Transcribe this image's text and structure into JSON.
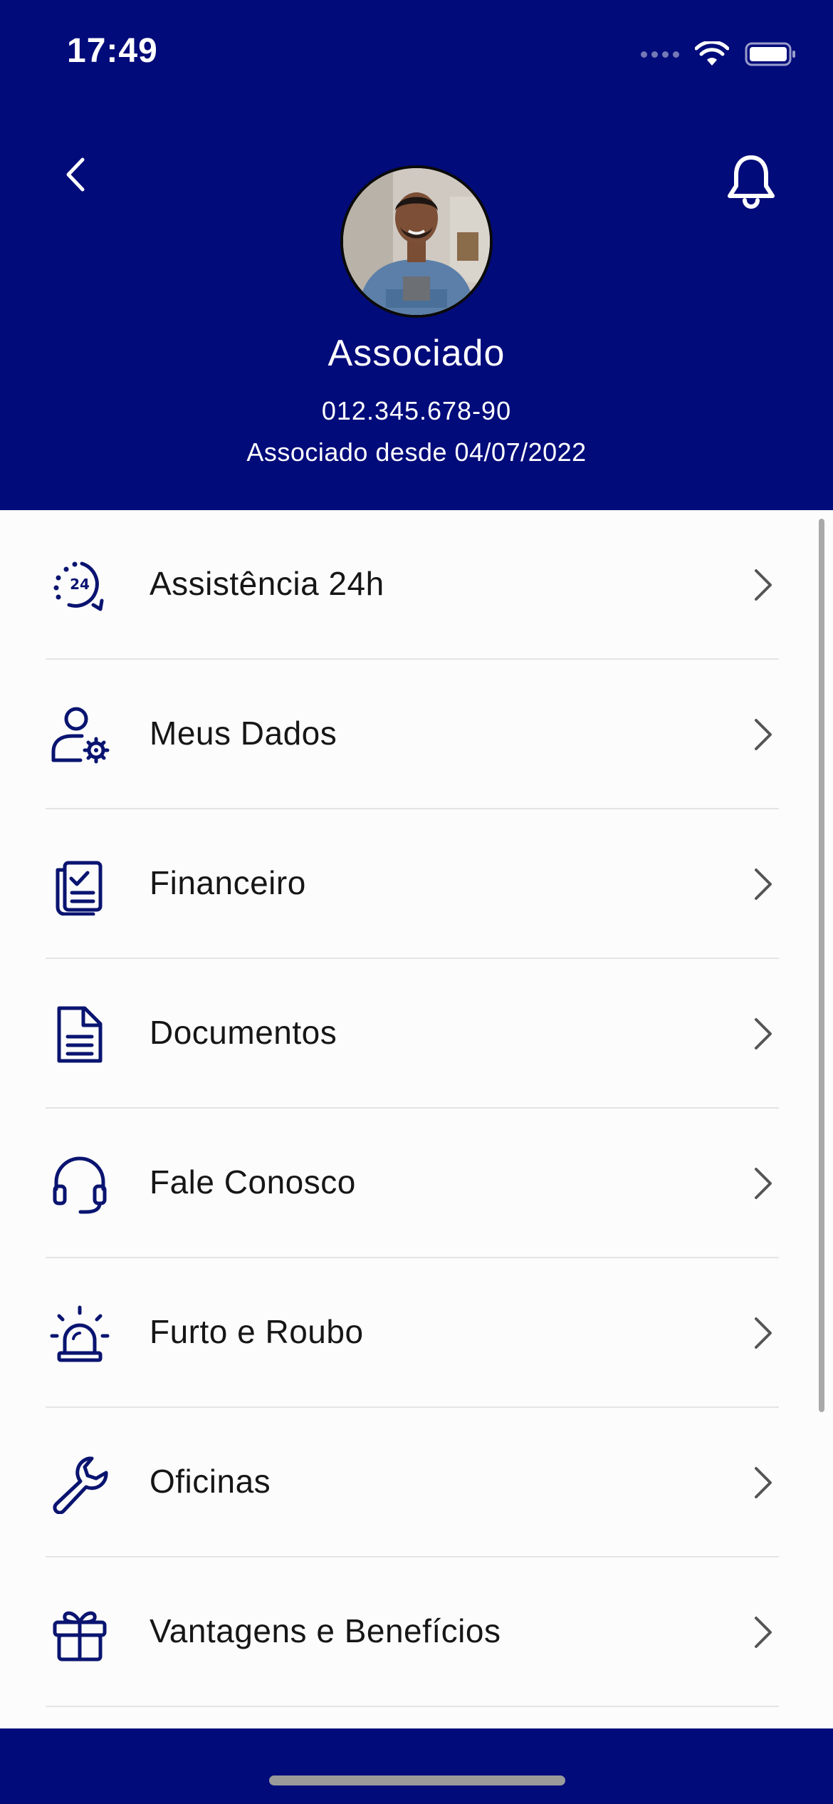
{
  "status_bar": {
    "time": "17:49",
    "icons": [
      "signal-dots-icon",
      "wifi-icon",
      "battery-icon"
    ]
  },
  "header": {
    "back_icon": "chevron-left-icon",
    "notification_icon": "bell-icon",
    "profile": {
      "name": "Associado",
      "document": "012.345.678-90",
      "member_since": "Associado desde 04/07/2022"
    }
  },
  "menu": {
    "items": [
      {
        "label": "Assistência 24h",
        "icon": "assistance-24h-icon"
      },
      {
        "label": "Meus Dados",
        "icon": "user-settings-icon"
      },
      {
        "label": "Financeiro",
        "icon": "financial-documents-icon"
      },
      {
        "label": "Documentos",
        "icon": "document-icon"
      },
      {
        "label": "Fale Conosco",
        "icon": "headset-icon"
      },
      {
        "label": "Furto e Roubo",
        "icon": "siren-icon"
      },
      {
        "label": "Oficinas",
        "icon": "wrench-icon"
      },
      {
        "label": "Vantagens e Benefícios",
        "icon": "gift-icon"
      }
    ]
  },
  "colors": {
    "primary": "#020B7A",
    "text": "#161616",
    "divider": "#E4E4E4",
    "chevron": "#555555",
    "icon": "#0A1470"
  }
}
